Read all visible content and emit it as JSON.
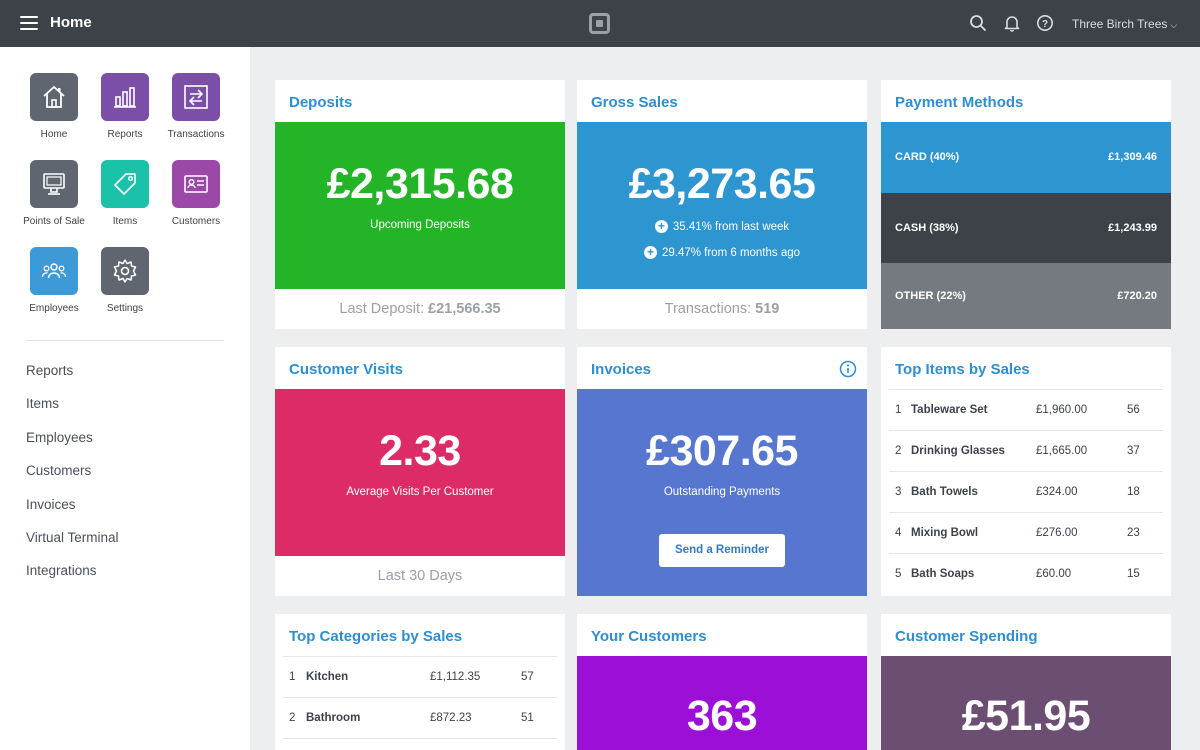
{
  "topbar": {
    "title": "Home",
    "merchant": "Three Birch Trees"
  },
  "apps": [
    {
      "label": "Home",
      "color": "#5f6670",
      "icon": "home-icon"
    },
    {
      "label": "Reports",
      "color": "#7b4fa8",
      "icon": "bar-chart-icon"
    },
    {
      "label": "Transactions",
      "color": "#7b4fa8",
      "icon": "transfer-arrows-icon"
    },
    {
      "label": "Points of Sale",
      "color": "#5f6670",
      "icon": "monitor-icon"
    },
    {
      "label": "Items",
      "color": "#1cc1aa",
      "icon": "tag-icon"
    },
    {
      "label": "Customers",
      "color": "#9b48a8",
      "icon": "id-card-icon"
    },
    {
      "label": "Employees",
      "color": "#3d9ad6",
      "icon": "people-icon"
    },
    {
      "label": "Settings",
      "color": "#5f6670",
      "icon": "gear-icon"
    }
  ],
  "nav": [
    "Reports",
    "Items",
    "Employees",
    "Customers",
    "Invoices",
    "Virtual Terminal",
    "Integrations"
  ],
  "deposits": {
    "title": "Deposits",
    "amount": "£2,315.68",
    "caption": "Upcoming Deposits",
    "foot_label": "Last Deposit:",
    "foot_value": "£21,566.35",
    "color": "#23b428"
  },
  "gross_sales": {
    "title": "Gross Sales",
    "amount": "£3,273.65",
    "stat1": "35.41% from last week",
    "stat2": "29.47% from 6 months ago",
    "foot_label": "Transactions:",
    "foot_value": "519",
    "color": "#2d95d0"
  },
  "payment_methods": {
    "title": "Payment Methods",
    "rows": [
      {
        "label": "CARD (40%)",
        "value": "£1,309.46",
        "color": "#2d95d0",
        "share": 0.4
      },
      {
        "label": "CASH (38%)",
        "value": "£1,243.99",
        "color": "#3d4249",
        "share": 0.38
      },
      {
        "label": "OTHER (22%)",
        "value": "£720.20",
        "color": "#757a80",
        "share": 0.22
      }
    ]
  },
  "customer_visits": {
    "title": "Customer Visits",
    "amount": "2.33",
    "caption": "Average Visits Per Customer",
    "foot": "Last 30 Days",
    "color": "#dc2b66"
  },
  "invoices": {
    "title": "Invoices",
    "amount": "£307.65",
    "caption": "Outstanding Payments",
    "button": "Send a Reminder",
    "color": "#5676cf"
  },
  "top_items": {
    "title": "Top Items by Sales",
    "rows": [
      {
        "n": "1",
        "name": "Tableware Set",
        "amount": "£1,960.00",
        "qty": "56"
      },
      {
        "n": "2",
        "name": "Drinking Glasses",
        "amount": "£1,665.00",
        "qty": "37"
      },
      {
        "n": "3",
        "name": "Bath Towels",
        "amount": "£324.00",
        "qty": "18"
      },
      {
        "n": "4",
        "name": "Mixing Bowl",
        "amount": "£276.00",
        "qty": "23"
      },
      {
        "n": "5",
        "name": "Bath Soaps",
        "amount": "£60.00",
        "qty": "15"
      }
    ]
  },
  "top_categories": {
    "title": "Top Categories by Sales",
    "rows": [
      {
        "n": "1",
        "name": "Kitchen",
        "amount": "£1,112.35",
        "qty": "57"
      },
      {
        "n": "2",
        "name": "Bathroom",
        "amount": "£872.23",
        "qty": "51"
      }
    ]
  },
  "your_customers": {
    "title": "Your Customers",
    "amount": "363",
    "color": "#9b0fd6"
  },
  "customer_spending": {
    "title": "Customer Spending",
    "amount": "£51.95",
    "color": "#6b4e72"
  }
}
